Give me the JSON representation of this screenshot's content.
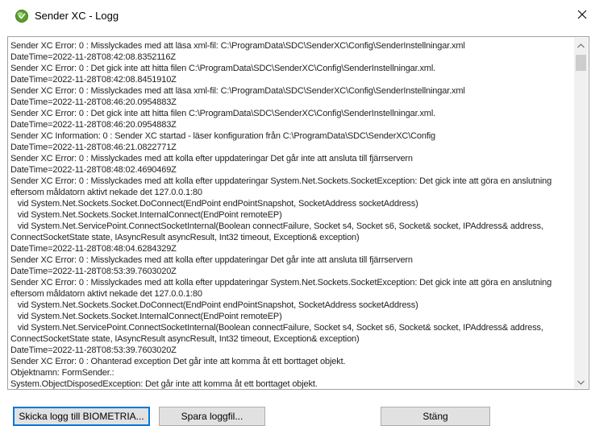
{
  "window": {
    "title": "Sender XC - Logg",
    "icon": "sender-xc-app-icon",
    "close_icon": "close-icon"
  },
  "log": {
    "lines": [
      "Sender XC Error: 0 : Misslyckades med att läsa xml-fil: C:\\ProgramData\\SDC\\SenderXC\\Config\\SenderInstellningar.xml",
      "DateTime=2022-11-28T08:42:08.8352116Z",
      "Sender XC Error: 0 : Det gick inte att hitta filen C:\\ProgramData\\SDC\\SenderXC\\Config\\SenderInstellningar.xml.",
      "DateTime=2022-11-28T08:42:08.8451910Z",
      "Sender XC Error: 0 : Misslyckades med att läsa xml-fil: C:\\ProgramData\\SDC\\SenderXC\\Config\\SenderInstellningar.xml",
      "DateTime=2022-11-28T08:46:20.0954883Z",
      "Sender XC Error: 0 : Det gick inte att hitta filen C:\\ProgramData\\SDC\\SenderXC\\Config\\SenderInstellningar.xml.",
      "DateTime=2022-11-28T08:46:20.0954883Z",
      "Sender XC Information: 0 : Sender XC startad - läser konfiguration från C:\\ProgramData\\SDC\\SenderXC\\Config",
      "DateTime=2022-11-28T08:46:21.0822771Z",
      "Sender XC Error: 0 : Misslyckades med att kolla efter uppdateringar Det går inte att ansluta till fjärrservern",
      "DateTime=2022-11-28T08:48:02.4690469Z",
      "Sender XC Error: 0 : Misslyckades med att kolla efter uppdateringar System.Net.Sockets.SocketException: Det gick inte att göra en anslutning eftersom måldatorn aktivt nekade det 127.0.0.1:80",
      "   vid System.Net.Sockets.Socket.DoConnect(EndPoint endPointSnapshot, SocketAddress socketAddress)",
      "   vid System.Net.Sockets.Socket.InternalConnect(EndPoint remoteEP)",
      "   vid System.Net.ServicePoint.ConnectSocketInternal(Boolean connectFailure, Socket s4, Socket s6, Socket& socket, IPAddress& address, ConnectSocketState state, IAsyncResult asyncResult, Int32 timeout, Exception& exception)",
      "DateTime=2022-11-28T08:48:04.6284329Z",
      "Sender XC Error: 0 : Misslyckades med att kolla efter uppdateringar Det går inte att ansluta till fjärrservern",
      "DateTime=2022-11-28T08:53:39.7603020Z",
      "Sender XC Error: 0 : Misslyckades med att kolla efter uppdateringar System.Net.Sockets.SocketException: Det gick inte att göra en anslutning eftersom måldatorn aktivt nekade det 127.0.0.1:80",
      "   vid System.Net.Sockets.Socket.DoConnect(EndPoint endPointSnapshot, SocketAddress socketAddress)",
      "   vid System.Net.Sockets.Socket.InternalConnect(EndPoint remoteEP)",
      "   vid System.Net.ServicePoint.ConnectSocketInternal(Boolean connectFailure, Socket s4, Socket s6, Socket& socket, IPAddress& address, ConnectSocketState state, IAsyncResult asyncResult, Int32 timeout, Exception& exception)",
      "DateTime=2022-11-28T08:53:39.7603020Z",
      "Sender XC Error: 0 : Ohanterad exception Det går inte att komma åt ett borttaget objekt.",
      "Objektnamn: FormSender.:",
      "System.ObjectDisposedException: Det går inte att komma åt ett borttaget objekt."
    ],
    "scrollbar": {
      "up_icon": "chevron-up-icon",
      "down_icon": "chevron-down-icon"
    }
  },
  "buttons": {
    "send_log_label": "Skicka logg till BIOMETRIA...",
    "save_log_label": "Spara loggfil...",
    "close_label": "Stäng"
  },
  "colors": {
    "button_face": "#e1e1e1",
    "button_border": "#adadad",
    "focus_border": "#0078d7",
    "log_text": "#222222",
    "icon_green": "#5aa02c"
  }
}
